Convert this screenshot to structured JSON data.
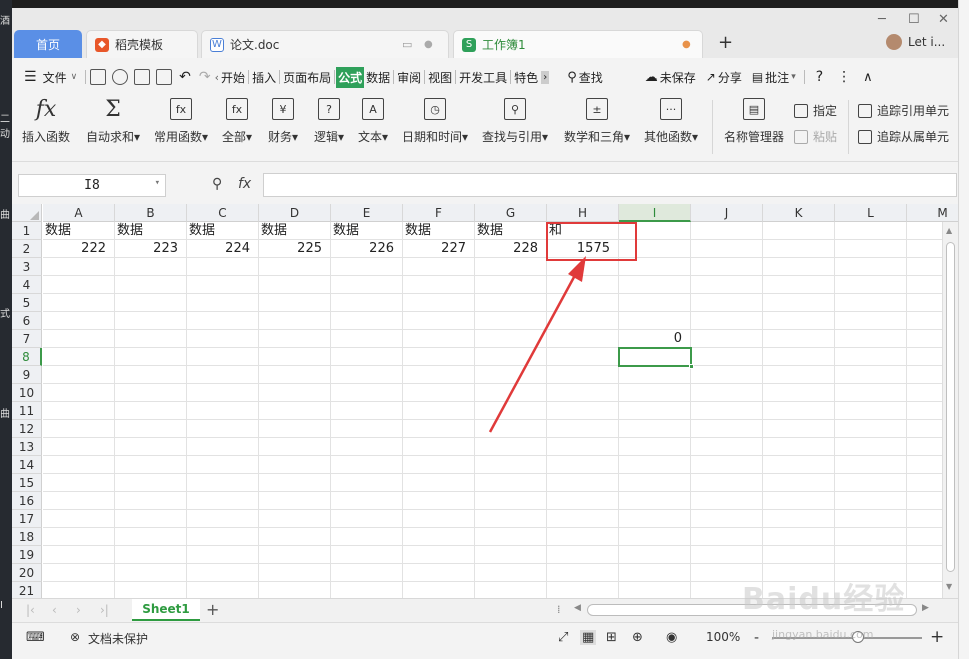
{
  "desktop_left_fragments": [
    "酒",
    "二",
    "动",
    "曲",
    "式",
    "曲",
    "I"
  ],
  "tabs": {
    "home": "首页",
    "template": "稻壳模板",
    "doc": "论文.doc",
    "active": "工作簿1",
    "new_tab": "+",
    "user": "Let i..."
  },
  "menu": {
    "file": "文件",
    "items": [
      "开始",
      "插入",
      "页面布局",
      "公式",
      "数据",
      "审阅",
      "视图",
      "开发工具",
      "特色"
    ],
    "active": "公式",
    "search": "查找",
    "unsaved": "未保存",
    "share": "分享",
    "comment": "批注",
    "help": "?"
  },
  "ribbon": {
    "insert_func": "插入函数",
    "autosum": "自动求和",
    "common": "常用函数",
    "all": "全部",
    "finance": "财务",
    "logic": "逻辑",
    "text": "文本",
    "datetime": "日期和时间",
    "lookup": "查找与引用",
    "math": "数学和三角",
    "other": "其他函数",
    "name_mgr": "名称管理器",
    "assign": "指定",
    "paste": "粘贴",
    "trace_prec": "追踪引用单元",
    "trace_dep": "追踪从属单元"
  },
  "formula_bar": {
    "name_box": "I8",
    "fx": "fx",
    "formula": ""
  },
  "grid": {
    "columns": [
      "A",
      "B",
      "C",
      "D",
      "E",
      "F",
      "G",
      "H",
      "I",
      "J",
      "K",
      "L",
      "M"
    ],
    "rows": [
      "1",
      "2",
      "3",
      "4",
      "5",
      "6",
      "7",
      "8",
      "9",
      "10",
      "11",
      "12",
      "13",
      "14",
      "15",
      "16",
      "17",
      "18",
      "19",
      "20",
      "21"
    ],
    "row1": [
      "数据",
      "数据",
      "数据",
      "数据",
      "数据",
      "数据",
      "数据",
      "和"
    ],
    "row2": [
      "222",
      "223",
      "224",
      "225",
      "226",
      "227",
      "228",
      "1575"
    ],
    "i7": "0",
    "selected_cell": "I8"
  },
  "sheet": {
    "tab": "Sheet1",
    "add": "+"
  },
  "status": {
    "protect": "文档未保护",
    "zoom": "100%",
    "minus": "-",
    "plus": "+"
  },
  "watermark": {
    "main": "Baidu经验",
    "sub": "jingyan.baidu.com"
  },
  "colors": {
    "accent": "#2fa05a",
    "home_tab": "#5a8fe6",
    "annotation": "#e03a3a"
  }
}
